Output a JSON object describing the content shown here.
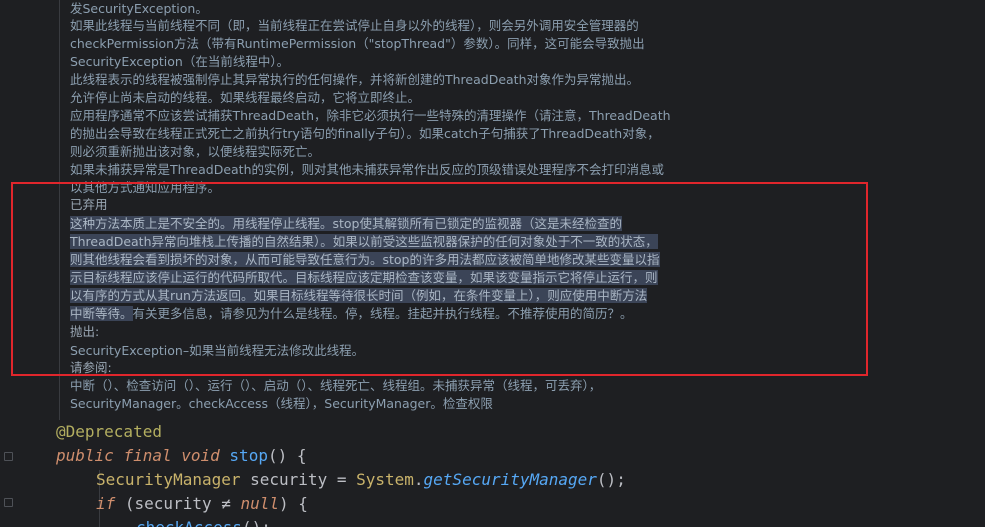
{
  "doc": {
    "lines": [
      "发SecurityException。",
      "如果此线程与当前线程不同（即，当前线程正在尝试停止自身以外的线程），则会另外调用安全管理器的",
      "checkPermission方法（带有RuntimePermission（\"stopThread\"）参数）。同样，这可能会导致抛出",
      "SecurityException（在当前线程中）。",
      "此线程表示的线程被强制停止其异常执行的任何操作，并将新创建的ThreadDeath对象作为异常抛出。",
      "允许停止尚未启动的线程。如果线程最终启动，它将立即终止。",
      "应用程序通常不应该尝试捕获ThreadDeath，除非它必须执行一些特殊的清理操作（请注意，ThreadDeath",
      "的抛出会导致在线程正式死亡之前执行try语句的finally子句）。如果catch子句捕获了ThreadDeath对象，",
      "则必须重新抛出该对象，以便线程实际死亡。",
      "如果未捕获异常是ThreadDeath的实例，则对其他未捕获异常作出反应的顶级错误处理程序不会打印消息或",
      "以其他方式通知应用程序。"
    ],
    "deprecated_heading": "已弃用",
    "deprecated_lines": [
      "这种方法本质上是不安全的。用线程停止线程。stop使其解锁所有已锁定的监视器（这是未经检查的",
      "ThreadDeath异常向堆栈上传播的自然结果）。如果以前受这些监视器保护的任何对象处于不一致的状态，",
      "则其他线程会看到损坏的对象，从而可能导致任意行为。stop的许多用法都应该被简单地修改某些变量以指",
      "示目标线程应该停止运行的代码所取代。目标线程应该定期检查该变量，如果该变量指示它将停止运行，则",
      "以有序的方式从其run方法返回。如果目标线程等待很长时间（例如，在条件变量上），则应使用中断方法"
    ],
    "deprecated_last_selected": "中断等待。",
    "deprecated_last_rest": "有关更多信息，请参见为什么是线程。停，线程。挂起并执行线程。不推荐使用的简历？。",
    "throws_heading": "抛出:",
    "throws_text": "SecurityException–如果当前线程无法修改此线程。",
    "see_heading": "请参阅:",
    "see_lines": [
      "中断（）、检查访问（）、运行（）、启动（）、线程死亡、线程组。未捕获异常（线程，可丢弃），",
      "SecurityManager。checkAccess（线程），SecurityManager。检查权限"
    ]
  },
  "code": {
    "annotation": "@Deprecated",
    "line2": {
      "kw1": "public",
      "kw2": "final",
      "kw3": "void",
      "method": "stop",
      "rest": "() {"
    },
    "line3": {
      "type": "SecurityManager",
      "var": " security = ",
      "cls": "System",
      "dot": ".",
      "call": "getSecurityManager",
      "end": "();"
    },
    "line4": {
      "kw": "if",
      "cond": " (security ≠ ",
      "nul": "null",
      "end": ") {"
    },
    "line5": {
      "call": "checkAccess",
      "end": "();"
    }
  }
}
